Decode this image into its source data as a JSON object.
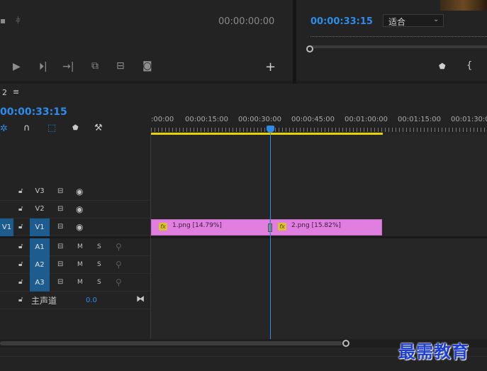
{
  "source_monitor": {
    "timecode": "00:00:00:00"
  },
  "program_monitor": {
    "timecode": "00:00:33:15",
    "fit_select": "适合"
  },
  "timeline": {
    "tab_label": "2",
    "menu_icon": "hamburger-menu-icon",
    "current_time": "00:00:33:15",
    "ruler_labels": [
      ":00:00",
      "00:00:15:00",
      "00:00:30:00",
      "00:00:45:00",
      "00:01:00:00",
      "00:01:15:00",
      "00:01:30:00"
    ],
    "tracks": {
      "video": [
        {
          "name": "V3"
        },
        {
          "name": "V2"
        },
        {
          "name": "V1",
          "source_patch": "V1"
        }
      ],
      "audio": [
        {
          "name": "A1",
          "mute": "M",
          "solo": "S"
        },
        {
          "name": "A2",
          "mute": "M",
          "solo": "S"
        },
        {
          "name": "A3",
          "mute": "M",
          "solo": "S"
        }
      ],
      "master": {
        "label": "主声道",
        "volume": "0.0"
      }
    },
    "clips": [
      {
        "fx": "fx",
        "label": "1.png [14.79%]"
      },
      {
        "fx": "fx",
        "label": "2.png [15.82%]"
      }
    ],
    "colors": {
      "accent": "#2d8ceb",
      "clip": "#e07fe0",
      "work_area_bar": "#e8d300",
      "track_target": "#1d5c8e"
    }
  },
  "watermark": "最需教育"
}
